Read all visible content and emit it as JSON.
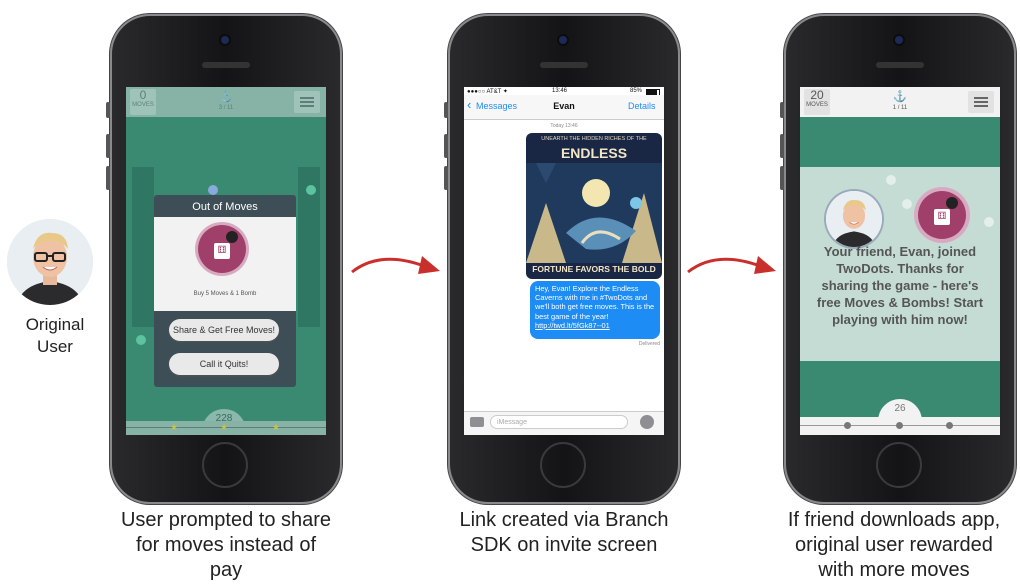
{
  "avatar_label": "Original\nUser",
  "captions": {
    "left": "User prompted to share\nfor moves instead of\npay",
    "middle": "Link created via Branch\nSDK on invite screen",
    "right": "If friend downloads app,\noriginal user rewarded\nwith more moves"
  },
  "phone1": {
    "moves_value": "0",
    "moves_label": "MOVES",
    "level": "3 / 11",
    "dialog_title": "Out of Moves",
    "offer_text": "Buy 5 Moves & 1 Bomb",
    "share_button": "Share & Get Free Moves!",
    "quit_button": "Call it Quits!",
    "score": "228"
  },
  "phone2": {
    "carrier": "●●●○○ AT&T ✦",
    "time": "13:46",
    "battery": "85%",
    "back_label": "Messages",
    "contact": "Evan",
    "details": "Details",
    "timestamp": "Today 13:46",
    "poster_top": "UNEARTH THE HIDDEN RICHES OF THE",
    "poster_title": "ENDLESS CAVERNS",
    "poster_bottom": "FORTUNE FAVORS THE BOLD",
    "message": "Hey, Evan! Explore the Endless Caverns with me in #TwoDots and we'll both get free moves. This is the best game of the year!",
    "link": "http://twd.lt/5fGk87--01",
    "delivered": "Delivered",
    "input_placeholder": "iMessage"
  },
  "phone3": {
    "moves_value": "20",
    "moves_label": "MOVES",
    "level": "1 / 11",
    "reward_text": "Your friend, Evan, joined TwoDots. Thanks for sharing the game - here's free Moves & Bombs! Start playing with him now!",
    "score": "26"
  },
  "colors": {
    "game_green": "#3a8a72",
    "arrow_red": "#c9302c",
    "imessage_blue": "#1e8cf5"
  }
}
